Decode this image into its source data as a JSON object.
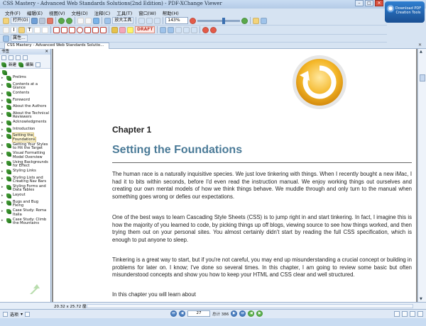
{
  "window": {
    "title": "CSS Mastery - Advanced Web Standards Solutions(2nd Edition) - PDF-XChange Viewer",
    "badge": "Download PDF Creation Tools"
  },
  "menu": [
    "文件(F)",
    "编辑(E)",
    "视图(V)",
    "文档(D)",
    "注释(C)",
    "工具(T)",
    "窗口(W)",
    "帮助(H)"
  ],
  "toolbar": {
    "open_label": "打开(O)",
    "print_label": "打印(P)",
    "zoom_tool": "放大工具",
    "stamp_label": "DRAFT",
    "zoom_value": "143%",
    "properties_label": "属性..."
  },
  "document_tab": "CSS Mastery - Advanced Web Standards Solutio...",
  "sidebar": {
    "title": "书签",
    "new_label": "新建",
    "edit_label": "编辑",
    "bottom_tab": "书签",
    "bookmarks": [
      "Prelims",
      "Contents at a Glance",
      "Contents",
      "Foreword",
      "About the Authors",
      "About the Technical Reviewers",
      "Acknowledgments",
      "Introduction",
      "Setting the Foundations",
      "Getting Your Styles to Hit the Target",
      "Visual Formatting Model Overview",
      "Using Backgrounds for Effect",
      "Styling Links",
      "Styling Lists and Creating Nav Bars",
      "Styling Forms and Data Tables",
      "Layout",
      "Bugs and Bug Fixing",
      "Case Study: Roma Italia",
      "Case Study: Climb the Mountains"
    ],
    "selected_index": 8
  },
  "page": {
    "chapter": "Chapter 1",
    "title": "Setting the Foundations",
    "paragraphs": [
      "The human race is a naturally inquisitive species. We just love tinkering with things. When I recently bought a new iMac, I had it to bits within seconds, before I'd even read the instruction manual. We enjoy working things out ourselves and creating our own mental models of how we think things behave. We muddle through and only turn to the manual when something goes wrong or defies our expectations.",
      "One of the best ways to learn Cascading Style Sheets (CSS) is to jump right in and start tinkering. In fact, I imagine this is how the majority of you learned to code, by picking things up off blogs, viewing source to see how things worked, and then trying them out on your personal sites. You almost certainly didn't start by reading the full CSS specification, which is enough to put anyone to sleep.",
      "Tinkering is a great way to start, but if you're not careful, you may end up misunderstanding a crucial concept or building in problems for later on. I know; I've done so several times. In this chapter, I am going to review some basic but often misunderstood concepts and show you how to keep your HTML and CSS clear and well structured.",
      "In this chapter you will learn about"
    ]
  },
  "status": {
    "page_size": "20.32 x 25.72 厘米"
  },
  "nav": {
    "options_label": "选项",
    "current_page": "27",
    "page_count_label": "总计 386"
  }
}
